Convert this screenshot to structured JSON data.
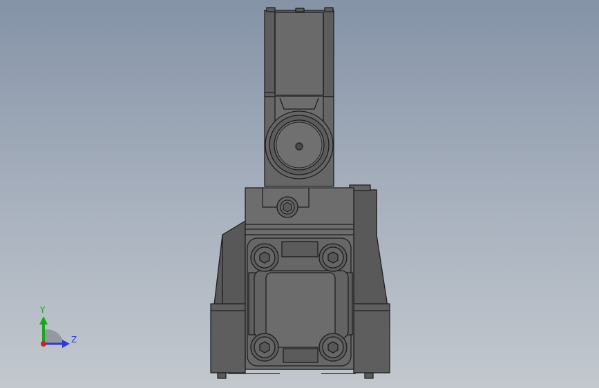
{
  "viewport": {
    "background_top": "#8593a7",
    "background_bottom": "#c3c8ce"
  },
  "model": {
    "body_color": "#6a6a6a",
    "shade_color": "#575757",
    "edge_color": "#1e1e1e"
  },
  "triad": {
    "y_label": "Y",
    "z_label": "Z",
    "y_color": "#1ea51e",
    "z_color": "#2f3bd1",
    "x_color": "#d12020"
  }
}
